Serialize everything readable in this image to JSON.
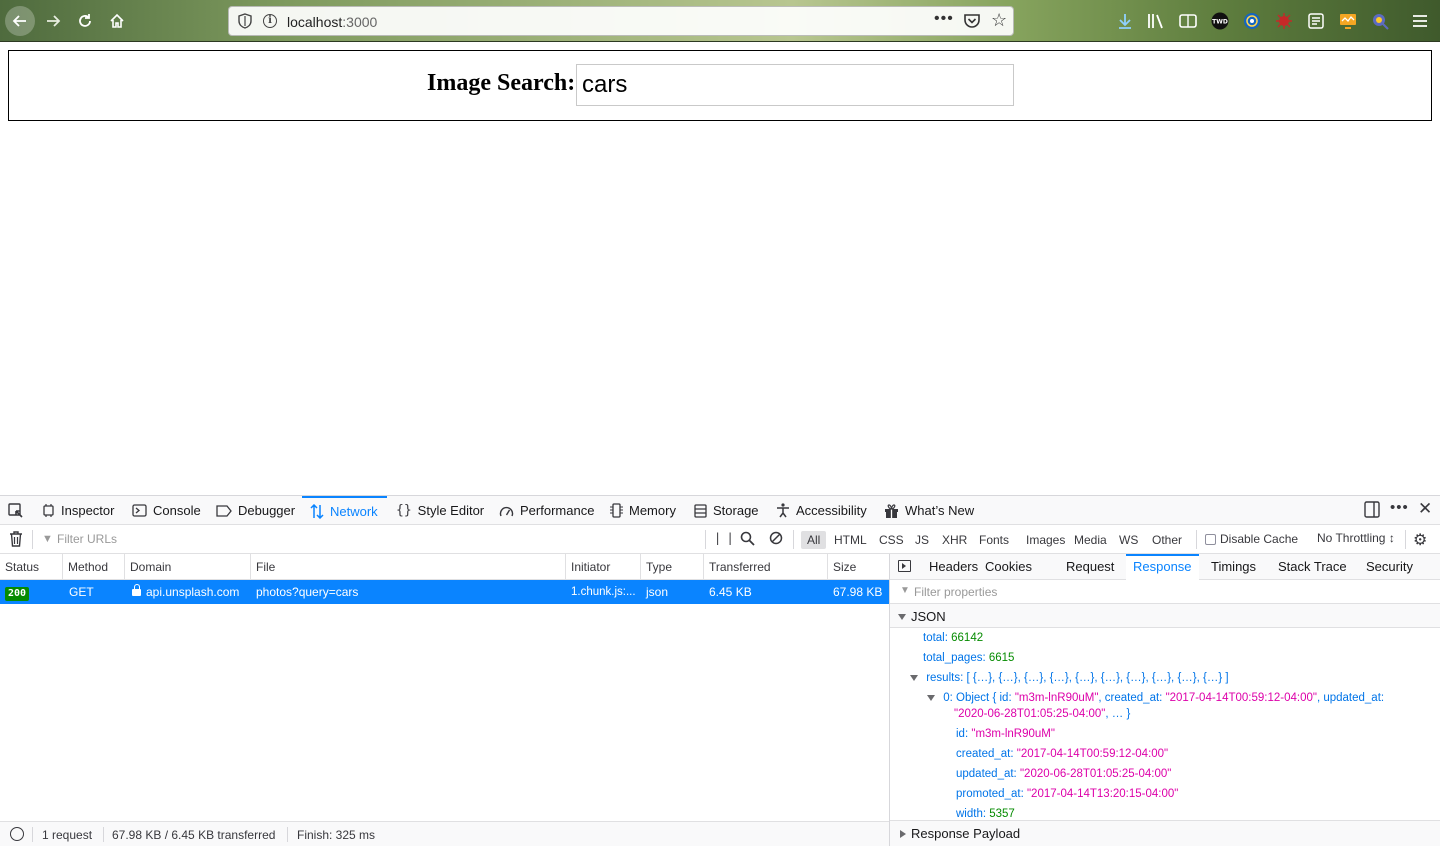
{
  "browser": {
    "url_host": "localhost",
    "url_port": ":3000",
    "icons": [
      "back-icon",
      "forward-icon",
      "reload-icon",
      "home-icon",
      "shield-icon",
      "info-icon",
      "more-dots-icon",
      "pocket-icon",
      "bookmark-star-icon",
      "download-icon",
      "library-icon",
      "reader-icon",
      "menu-icon"
    ]
  },
  "page": {
    "search_label": "Image Search:",
    "search_value": "cars"
  },
  "devtools": {
    "tabs": [
      {
        "label": "Inspector"
      },
      {
        "label": "Console"
      },
      {
        "label": "Debugger"
      },
      {
        "label": "Network"
      },
      {
        "label": "Style Editor"
      },
      {
        "label": "Performance"
      },
      {
        "label": "Memory"
      },
      {
        "label": "Storage"
      },
      {
        "label": "Accessibility"
      },
      {
        "label": "What’s New"
      }
    ],
    "selected_tab": "Network",
    "filter_placeholder": "Filter URLs",
    "type_filters": [
      "All",
      "HTML",
      "CSS",
      "JS",
      "XHR",
      "Fonts",
      "Images",
      "Media",
      "WS",
      "Other"
    ],
    "disable_cache_label": "Disable Cache",
    "throttling_label": "No Throttling ↕",
    "columns": [
      "Status",
      "Method",
      "Domain",
      "File",
      "Initiator",
      "Type",
      "Transferred",
      "Size"
    ],
    "request": {
      "status": "200",
      "method": "GET",
      "domain": "api.unsplash.com",
      "file": "photos?query=cars",
      "initiator": "1.chunk.js:...",
      "type": "json",
      "transferred": "6.45 KB",
      "size": "67.98 KB"
    },
    "status_bar": {
      "requests": "1 request",
      "transferred": "67.98 KB / 6.45 KB transferred",
      "finish": "Finish: 325 ms"
    },
    "detail_tabs": [
      "Headers",
      "Cookies",
      "Request",
      "Response",
      "Timings",
      "Stack Trace",
      "Security"
    ],
    "selected_detail_tab": "Response",
    "filter_properties": "Filter properties",
    "json_label": "JSON",
    "json_tree": {
      "total_key": "total:",
      "total_val": "66142",
      "total_pages_key": "total_pages:",
      "total_pages_val": "6615",
      "results_key": "results:",
      "results_val": "[ {…}, {…}, {…}, {…}, {…}, {…}, {…}, {…}, {…}, {…} ]",
      "item0_key": "0:",
      "item0_type": "Object",
      "item0_open": "{ id:",
      "item0_id": "\"m3m-lnR90uM\"",
      "item0_created_key": ", created_at:",
      "item0_created": "\"2017-04-14T00:59:12-04:00\"",
      "item0_updated_key": ", updated_at:",
      "item0_updated": "\"2020-06-28T01:05:25-04:00\"",
      "item0_rest": ", … }",
      "id_key": "id:",
      "id_val": "\"m3m-lnR90uM\"",
      "created_key": "created_at:",
      "created_val": "\"2017-04-14T00:59:12-04:00\"",
      "updated_key": "updated_at:",
      "updated_val": "\"2020-06-28T01:05:25-04:00\"",
      "promoted_key": "promoted_at:",
      "promoted_val": "\"2017-04-14T13:20:15-04:00\"",
      "width_key": "width:",
      "width_val": "5357"
    },
    "response_payload_label": "Response Payload"
  },
  "colors": {
    "accent": "#0a84ff",
    "status_ok": "#058b00",
    "json_key": "#0074e8",
    "json_string": "#dd00a9",
    "json_number": "#058b00"
  }
}
